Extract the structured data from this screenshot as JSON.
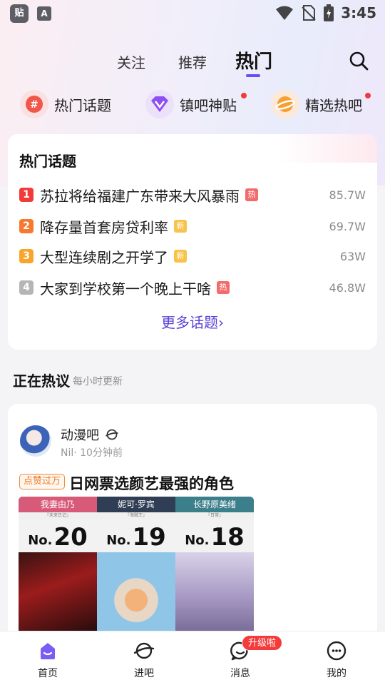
{
  "status_bar": {
    "time": "3:45",
    "app_icon_text": "贴",
    "a_icon_text": "A"
  },
  "header": {
    "tabs": [
      {
        "label": "关注"
      },
      {
        "label": "推荐"
      },
      {
        "label": "热门"
      }
    ]
  },
  "shortcuts": [
    {
      "label": "热门话题"
    },
    {
      "label": "镇吧神贴"
    },
    {
      "label": "精选热吧"
    }
  ],
  "hot_topics": {
    "title": "热门话题",
    "items": [
      {
        "rank": "1",
        "text": "苏拉将给福建广东带来大风暴雨",
        "tag": "热",
        "count": "85.7W"
      },
      {
        "rank": "2",
        "text": "降存量首套房贷利率",
        "tag": "新",
        "count": "69.7W"
      },
      {
        "rank": "3",
        "text": "大型连续剧之开学了",
        "tag": "新",
        "count": "63W"
      },
      {
        "rank": "4",
        "text": "大家到学校第一个晚上干啥",
        "tag": "热",
        "count": "46.8W"
      }
    ],
    "more": "更多话题›"
  },
  "section": {
    "title": "正在热议",
    "subtitle": "每小时更新"
  },
  "post": {
    "forum": "动漫吧",
    "meta": "Nil·  10分钟前",
    "badge": "点赞过万",
    "title": "日网票选颜艺最强的角色",
    "image_ranks": [
      {
        "name": "我妻由乃",
        "sub": "『未来日记』",
        "no": "No.",
        "num": "20"
      },
      {
        "name": "妮可·罗宾",
        "sub": "『海贼王』",
        "no": "No.",
        "num": "19"
      },
      {
        "name": "长野原美绪",
        "sub": "『日常』",
        "no": "No.",
        "num": "18"
      }
    ]
  },
  "bottom_nav": {
    "items": [
      {
        "label": "首页"
      },
      {
        "label": "进吧"
      },
      {
        "label": "消息"
      },
      {
        "label": "我的"
      }
    ],
    "upgrade_badge": "升级啦"
  },
  "colors": {
    "accent": "#6a4df2",
    "rank1": "#f23a3a",
    "rank2": "#f7792e",
    "rank3": "#f9a529",
    "rank4": "#b5b5b5",
    "tag_hot": "#f36b6b",
    "tag_new": "#f9c24a"
  }
}
